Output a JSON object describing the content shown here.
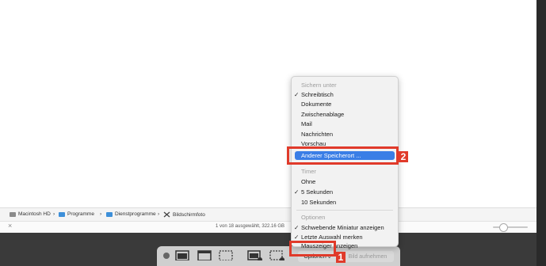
{
  "path_bar": {
    "items": [
      "Macintosh HD",
      "Programme",
      "Dienstprogramme",
      "Bildschirmfoto"
    ],
    "separator": "›"
  },
  "status": {
    "text": "1 von 18 ausgewählt, 322.16 GB"
  },
  "menu": {
    "save_header": "Sichern unter",
    "save_items": [
      "Schreibtisch",
      "Dokumente",
      "Zwischenablage",
      "Mail",
      "Nachrichten",
      "Vorschau"
    ],
    "other_location": "Anderer Speicherort ...",
    "timer_header": "Timer",
    "timer_items": [
      "Ohne",
      "5 Sekunden",
      "10 Sekunden"
    ],
    "options_header": "Optionen",
    "option_items": [
      "Schwebende Miniatur anzeigen",
      "Letzte Auswahl merken",
      "Mauszeiger anzeigen"
    ],
    "checkmark": "✓"
  },
  "toolbar": {
    "options_label": "Optionen",
    "options_caret": "⌄",
    "capture_label": "Bild aufnehmen"
  },
  "annotations": {
    "badge_1": "1",
    "badge_2": "2"
  },
  "colors": {
    "highlight": "#3a7ee6",
    "annotation_red": "#e03a2a",
    "toolbar": "#cfcfcf"
  },
  "icons": [
    "close-icon",
    "disk-icon",
    "folder-icon",
    "screenshot-app-icon",
    "capture-screen-icon",
    "capture-window-icon",
    "capture-selection-icon",
    "record-screen-icon",
    "record-selection-icon"
  ]
}
